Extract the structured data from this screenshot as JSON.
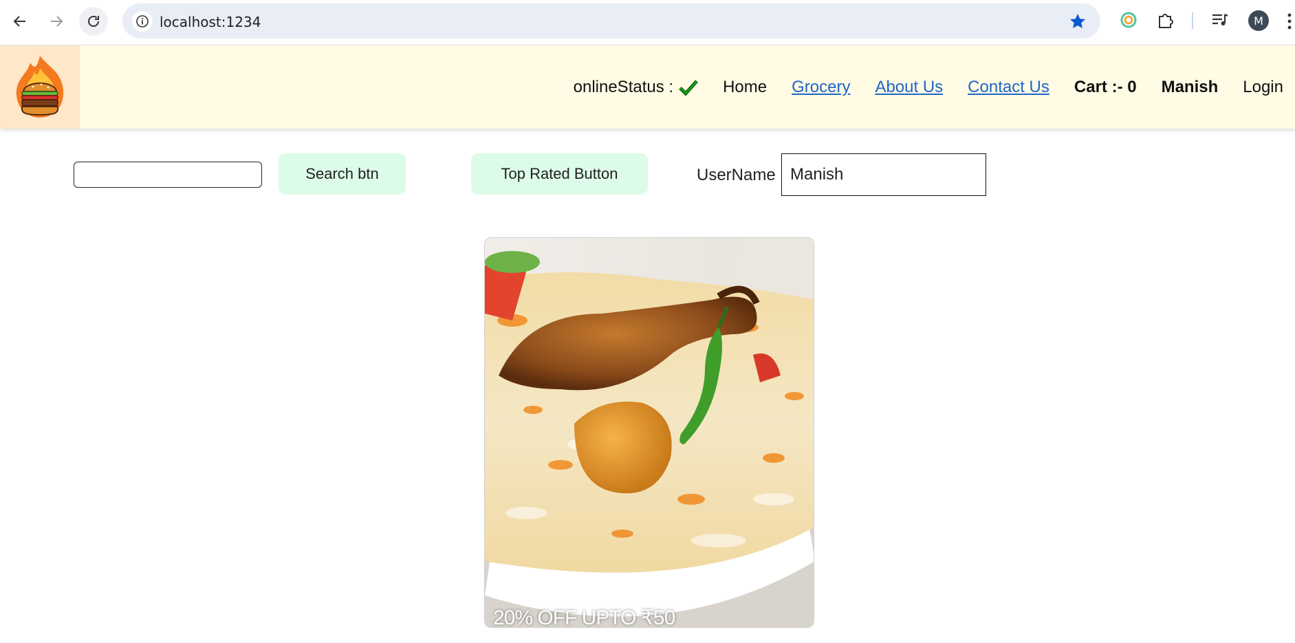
{
  "browser": {
    "url": "localhost:1234",
    "profile_initial": "M"
  },
  "header": {
    "online_label": "onlineStatus :",
    "nav": {
      "home": "Home",
      "grocery": "Grocery",
      "about": "About Us",
      "contact": "Contact Us",
      "cart": "Cart :- 0",
      "user": "Manish",
      "login": "Login"
    }
  },
  "filters": {
    "search_value": "",
    "search_button": "Search btn",
    "top_rated_button": "Top Rated Button",
    "username_label": "UserName :",
    "username_value": "Manish"
  },
  "card": {
    "offer": "20% OFF UPTO ₹50"
  },
  "colors": {
    "header_bg": "#fffbe5",
    "logo_bg": "#ffe7c9",
    "button_bg": "#dcfbe8",
    "link": "#1f64c8",
    "check": "#12a312"
  }
}
